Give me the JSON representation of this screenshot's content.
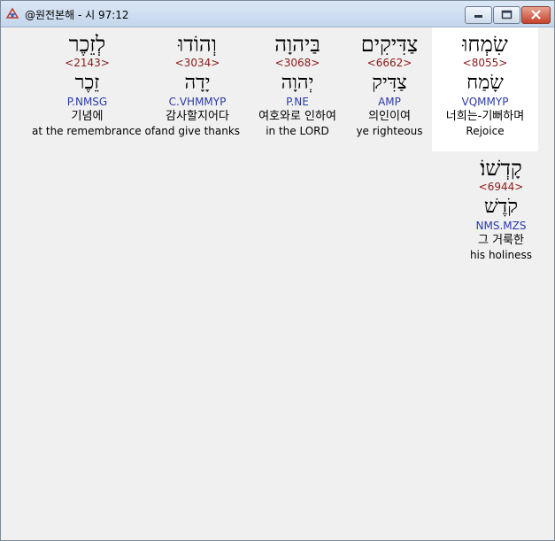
{
  "window": {
    "title": "@원전본해 - 시 97:12",
    "accent": "#c4422b"
  },
  "words": [
    {
      "hebrew": "שִׂמְחוּ",
      "strong": "<8055>",
      "lemma": "שָׂמַח",
      "morph": "VQMMYP",
      "korean": "너희는-기뻐하며",
      "english": "Rejoice"
    },
    {
      "hebrew": "צַדִּיקִים",
      "strong": "<6662>",
      "lemma": "צַדִּיק",
      "morph": "AMP",
      "korean": "의인이여",
      "english": "ye righteous"
    },
    {
      "hebrew": "בַּיהוָה",
      "strong": "<3068>",
      "lemma": "יְהוָה",
      "morph": "P.NE",
      "korean": "여호와로 인하여",
      "english": "in the LORD"
    },
    {
      "hebrew": "וְהוֹדוּ",
      "strong": "<3034>",
      "lemma": "יָדָה",
      "morph": "C.VHMMYP",
      "korean": "감사할지어다",
      "english": "and give thanks"
    },
    {
      "hebrew": "לְזֵכֶר",
      "strong": "<2143>",
      "lemma": "זֵכֶר",
      "morph": "P.NMSG",
      "korean": "기념에",
      "english": "at the remembrance of"
    },
    {
      "hebrew": "קָדְשׁוֹ׃",
      "strong": "<6944>",
      "lemma": "קֹדֶשׁ",
      "morph": "NMS.MZS",
      "korean": "그 거룩한",
      "english": "his holiness"
    }
  ]
}
